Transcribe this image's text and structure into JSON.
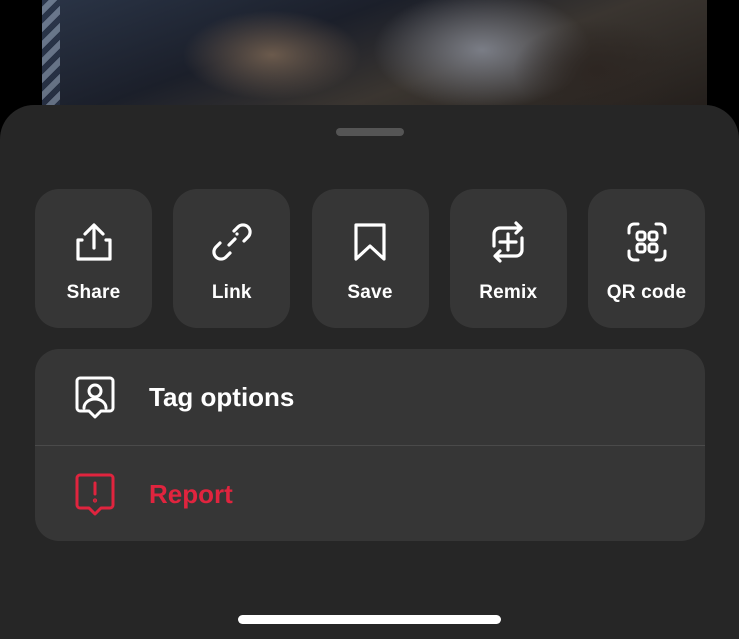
{
  "colors": {
    "sheet_background": "#262626",
    "card_background": "#363636",
    "text_primary": "#FFFFFF",
    "destructive": "#E0243E",
    "grabber": "#555555",
    "divider": "#4A4A4A"
  },
  "actions": [
    {
      "label": "Share",
      "icon": "share-icon"
    },
    {
      "label": "Link",
      "icon": "link-icon"
    },
    {
      "label": "Save",
      "icon": "bookmark-icon"
    },
    {
      "label": "Remix",
      "icon": "remix-icon"
    },
    {
      "label": "QR code",
      "icon": "qr-code-icon"
    }
  ],
  "menu": [
    {
      "label": "Tag options",
      "icon": "tag-person-icon",
      "color": "#FFFFFF"
    },
    {
      "label": "Report",
      "icon": "report-icon",
      "color": "#E0243E"
    }
  ]
}
